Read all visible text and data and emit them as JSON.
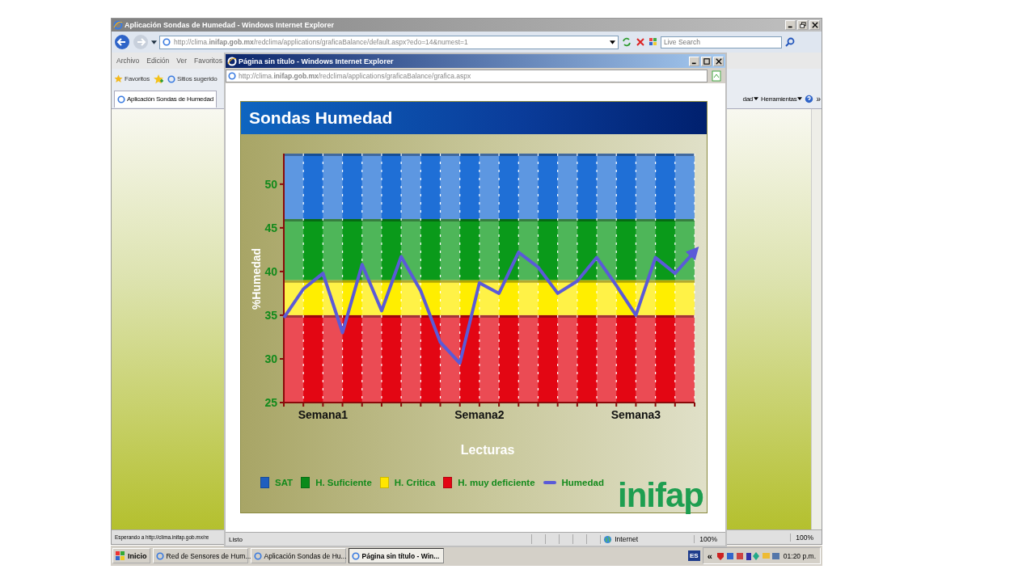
{
  "main_window": {
    "title": "Aplicación Sondas de Humedad - Windows Internet Explorer",
    "address": "http://clima.**inifap.gob.mx**/redclima/applications/graficaBalance/default.aspx?edo=14&numest=1",
    "search_placeholder": "Live Search",
    "menu": [
      "Archivo",
      "Edición",
      "Ver",
      "Favoritos"
    ],
    "favorites_button": "Favoritos",
    "suggested_sites": "Sitios sugerido",
    "tab": "Aplicación Sondas de Humedad",
    "commands": [
      "dad",
      "Herramientas"
    ],
    "overflow": "»",
    "status": "Esperando a http://clima.inifap.gob.mx/re",
    "zoom": "100%"
  },
  "popup": {
    "title": "Página sin título - Windows Internet Explorer",
    "address": "http://clima.**inifap.gob.mx**/redclima/applications/graficaBalance/grafica.aspx",
    "chart_title": "Sondas Humedad",
    "chart_data": {
      "type": "line",
      "xlabel": "Lecturas",
      "ylabel": "%Humedad",
      "categories": [
        null,
        null,
        "Semana1",
        null,
        null,
        null,
        null,
        null,
        null,
        null,
        "Semana2",
        null,
        null,
        null,
        null,
        null,
        null,
        null,
        "Semana3",
        null,
        null,
        null
      ],
      "series": [
        {
          "name": "Humedad",
          "color": "#5a5ad8",
          "values": [
            34.7,
            38.0,
            39.8,
            33.0,
            40.8,
            35.5,
            41.7,
            37.8,
            31.9,
            29.5,
            38.7,
            37.5,
            42.2,
            40.5,
            37.5,
            38.9,
            41.6,
            38.4,
            35.0,
            41.6,
            39.8,
            42.3
          ]
        }
      ],
      "ylim": [
        25,
        53.5
      ],
      "yticks": [
        25,
        30,
        35,
        40,
        45,
        50
      ],
      "grid": true,
      "bands": [
        {
          "axis": "y",
          "from": 46,
          "to": 53.5,
          "color": "#1f6fd6"
        },
        {
          "axis": "y",
          "from": 39,
          "to": 46,
          "color": "#0a9a1a"
        },
        {
          "axis": "y",
          "from": 35,
          "to": 39,
          "color": "#ffee00"
        },
        {
          "axis": "y",
          "from": 25,
          "to": 35,
          "color": "#e30613"
        }
      ]
    },
    "legend": [
      {
        "label": "SAT",
        "color": "#1f5fbf"
      },
      {
        "label": "H. Suficiente",
        "color": "#0a8a1a"
      },
      {
        "label": "H. Critica",
        "color": "#ffe600"
      },
      {
        "label": "H. muy deficiente",
        "color": "#e30613"
      }
    ],
    "logo": "inifap",
    "status": "Listo",
    "zone": "Internet",
    "zoom": "100%"
  },
  "taskbar": {
    "start": "Inicio",
    "tasks": [
      {
        "label": "Red de Sensores de Hum...",
        "selected": false
      },
      {
        "label": "Aplicación Sondas de Hu...",
        "selected": false
      },
      {
        "label": "Página sin título - Win...",
        "selected": true
      }
    ],
    "language": "ES",
    "tray_toggle": "«",
    "clock": "01:20 p.m."
  }
}
